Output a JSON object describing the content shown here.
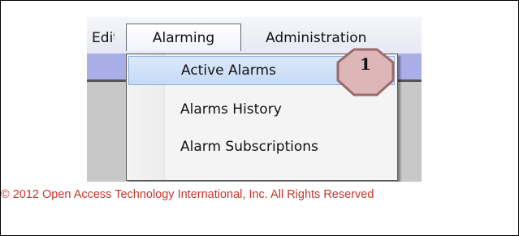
{
  "menubar": {
    "edit_label": "Edit",
    "alarming_label": "Alarming",
    "administration_label": "Administration"
  },
  "dropdown": {
    "items": [
      {
        "label": "Active Alarms"
      },
      {
        "label": "Alarms History"
      },
      {
        "label": "Alarm Subscriptions"
      }
    ]
  },
  "callout": {
    "number": "1"
  },
  "footer": {
    "copyright": "© 2012 Open Access Technology International, Inc. All Rights Reserved"
  },
  "colors": {
    "menubar_band": "#a9aee8",
    "highlight": "#c4dbf6",
    "callout_fill": "#ddb7b7",
    "callout_stroke": "#9b6a6a",
    "copyright_text": "#c0392b"
  }
}
